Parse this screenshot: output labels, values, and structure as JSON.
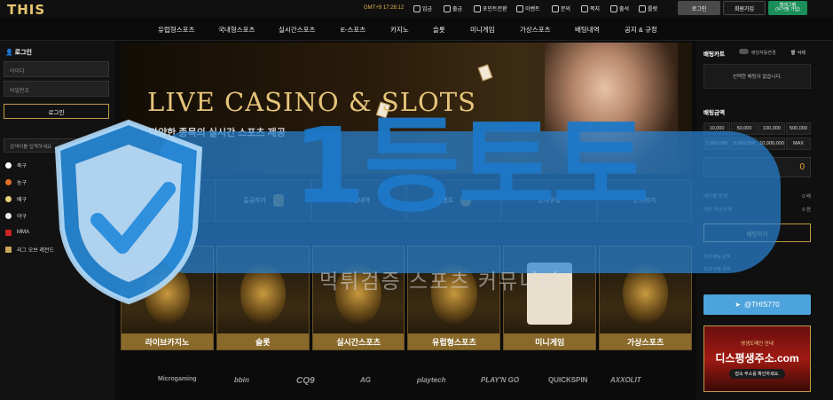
{
  "brand": {
    "logo": "THIS",
    "tagline": ""
  },
  "topbar": {
    "clock": "GMT+9 17:28:12",
    "links": [
      {
        "label": "입금",
        "icon": "wallet-icon"
      },
      {
        "label": "출금",
        "icon": "withdraw-icon"
      },
      {
        "label": "포인트전환",
        "icon": "point-icon"
      },
      {
        "label": "이벤트",
        "icon": "gift-icon"
      },
      {
        "label": "문의",
        "icon": "chat-icon"
      },
      {
        "label": "쪽지",
        "icon": "mail-icon"
      },
      {
        "label": "출석",
        "icon": "calendar-icon"
      },
      {
        "label": "룰렛",
        "icon": "roulette-icon"
      }
    ],
    "login_label": "로그인",
    "join_label": "회원가입",
    "telegram_line1": "텔레그램",
    "telegram_line2": "(우거맹 가입)"
  },
  "nav": [
    "유럽형스포츠",
    "국내형스포츠",
    "실시간스포츠",
    "E-스포츠",
    "카지노",
    "슬롯",
    "미니게임",
    "가상스포츠",
    "배팅내역",
    "공지 & 규정"
  ],
  "left": {
    "login_heading": "로그인",
    "id_placeholder": "아이디",
    "pw_placeholder": "비밀번호",
    "login_button": "로그인",
    "search_placeholder": "검색어를 입력하세요",
    "sports": [
      {
        "label": "축구",
        "color": "#ffffff"
      },
      {
        "label": "농구",
        "color": "#e0702a"
      },
      {
        "label": "배구",
        "color": "#e8d27a"
      },
      {
        "label": "야구",
        "color": "#eeeeee"
      },
      {
        "label": "MMA",
        "color": "#c22"
      },
      {
        "label": "리그 오브 레전드",
        "color": "#c9a65a"
      }
    ]
  },
  "hero": {
    "title": "LIVE CASINO & SLOTS",
    "subtitle": "다양한 종목의 실시간 스포츠 제공"
  },
  "quick": [
    "입금하기",
    "출금하기",
    "배팅내역",
    "이벤트",
    "공지규정",
    "문의하기"
  ],
  "games": [
    "라이브카지노",
    "슬롯",
    "실시간스포츠",
    "유럽형스포츠",
    "미니게임",
    "가상스포츠"
  ],
  "providers": [
    "Microgaming",
    "bbin",
    "CQ9",
    "AG",
    "playtech",
    "PLAY'N GO",
    "QUICKSPIN",
    "AXXOLIT"
  ],
  "right": {
    "cart_title": "배팅카트",
    "auto_label": "배당자동변경",
    "delete_label": "삭제",
    "empty_message": "선택한 배팅이 없습니다.",
    "amount_title": "배팅금액",
    "amounts": [
      "10,000",
      "50,000",
      "100,000",
      "500,000",
      "1,000,000",
      "5,000,000",
      "10,000,000",
      "MAX"
    ],
    "left_value": "0",
    "sum_value": "0",
    "rows": [
      {
        "label": "배당률 합계",
        "value": "0 배"
      },
      {
        "label": "예상 적중금액",
        "value": "0 원"
      }
    ],
    "bet_button": "배팅하기",
    "max_bet": "최대 배팅 금액",
    "max_win": "최대 당첨 금액",
    "telegram_handle": "@THIS770",
    "banner_line1": "영생도메인 안내",
    "banner_line2": "디스평생주소.com",
    "banner_line3": "접속 주소를 확인하세요."
  },
  "watermark": {
    "title": "1등토토",
    "subtitle": "먹튀검증 스포츠 커뮤니티"
  },
  "colors": {
    "gold": "#c29a48",
    "accent": "#e8b54a",
    "telegram": "#4da3dc",
    "watermark": "#2882d2"
  }
}
